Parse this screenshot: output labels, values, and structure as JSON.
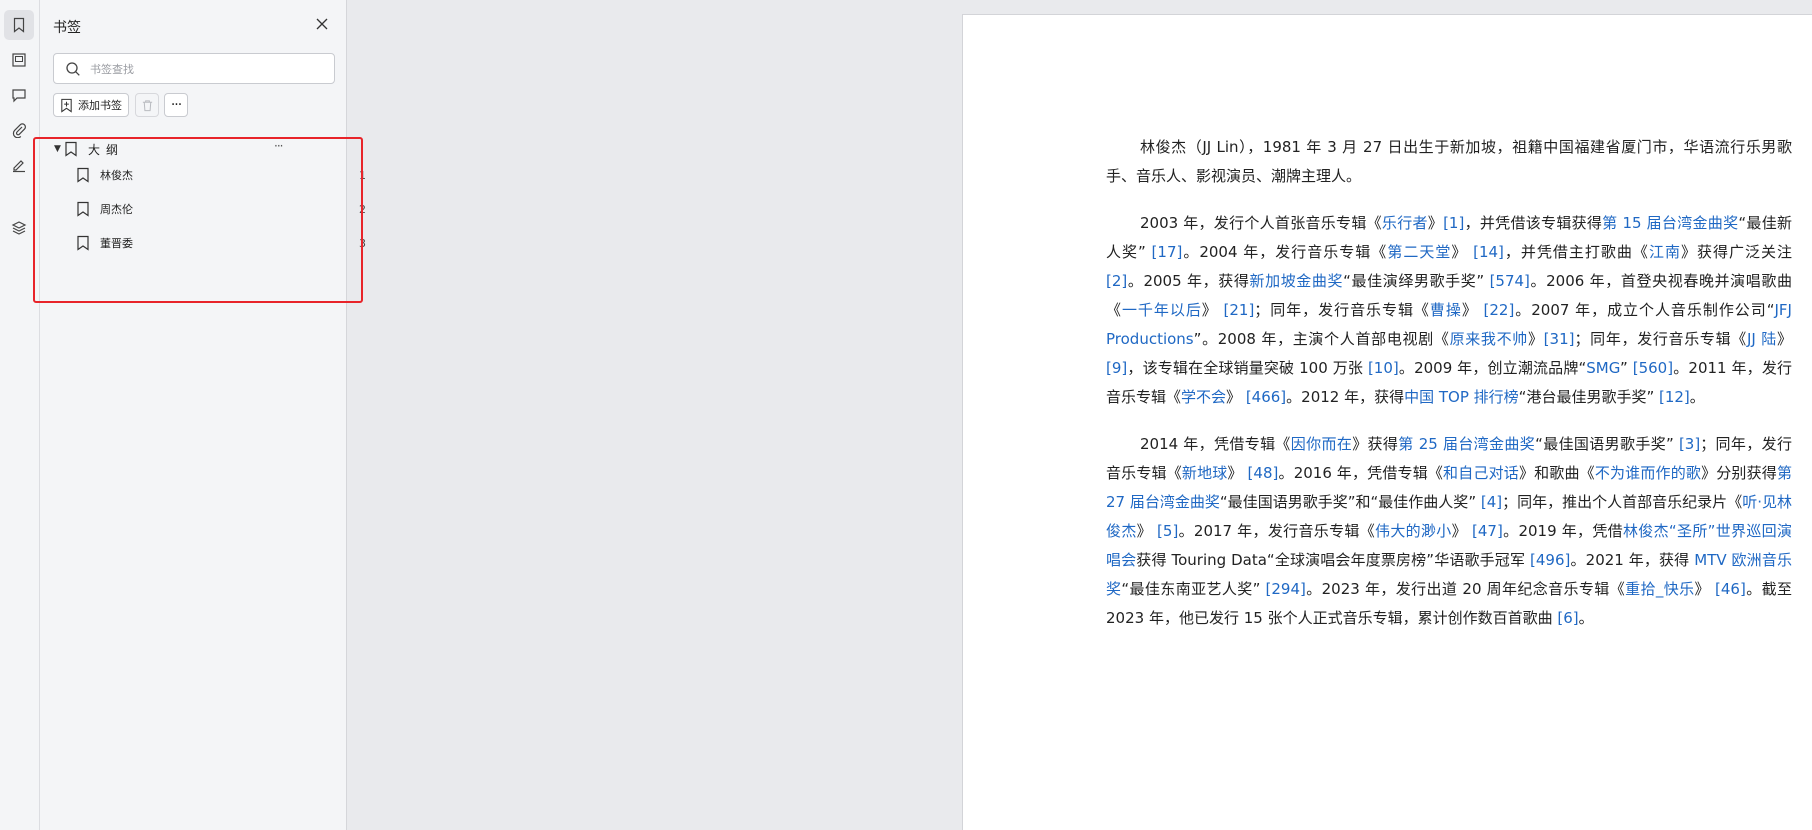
{
  "rail": {
    "items": [
      {
        "icon": "bookmark-icon",
        "active": true
      },
      {
        "icon": "image-icon",
        "active": false
      },
      {
        "icon": "comment-icon",
        "active": false
      },
      {
        "icon": "attachment-icon",
        "active": false
      },
      {
        "icon": "signature-icon",
        "active": false
      },
      {
        "icon": "layers-icon",
        "active": false
      }
    ]
  },
  "bookmark_panel": {
    "title": "书签",
    "search_placeholder": "书签查找",
    "add_label": "添加书签",
    "more_glyph": "···",
    "root": {
      "label": "大纲",
      "more": "···"
    },
    "items": [
      {
        "label": "林俊杰",
        "page": "1"
      },
      {
        "label": "周杰伦",
        "page": "2"
      },
      {
        "label": "董晋委",
        "page": "3"
      }
    ],
    "highlight_color": "#e8242a"
  },
  "document": {
    "link_color": "#1f68c4",
    "paragraphs": [
      [
        {
          "t": "林俊杰（JJ Lin），1981 年 3 月 27 日出生于新加坡，祖籍中国福建省厦门市，华语流行乐男歌手、音乐人、影视演员、潮牌主理人。"
        }
      ],
      [
        {
          "t": "2003 年，发行个人首张音乐专辑《"
        },
        {
          "t": "乐行者",
          "link": true
        },
        {
          "t": "》"
        },
        {
          "t": "[1]",
          "link": true
        },
        {
          "t": "，并凭借该专辑获得"
        },
        {
          "t": "第 15 届台湾金曲奖",
          "link": true
        },
        {
          "t": "“最佳新人奖” "
        },
        {
          "t": "[17]",
          "link": true
        },
        {
          "t": "。2004 年，发行音乐专辑《"
        },
        {
          "t": "第二天堂",
          "link": true
        },
        {
          "t": "》 "
        },
        {
          "t": "[14]",
          "link": true
        },
        {
          "t": "，并凭借主打歌曲《"
        },
        {
          "t": "江南",
          "link": true
        },
        {
          "t": "》获得广泛关注 "
        },
        {
          "t": "[2]",
          "link": true
        },
        {
          "t": "。2005 年，获得"
        },
        {
          "t": "新加坡金曲奖",
          "link": true
        },
        {
          "t": "“最佳演绎男歌手奖” "
        },
        {
          "t": "[574]",
          "link": true
        },
        {
          "t": "。2006 年，首登央视春晚并演唱歌曲《"
        },
        {
          "t": "一千年以后",
          "link": true
        },
        {
          "t": "》 "
        },
        {
          "t": "[21]",
          "link": true
        },
        {
          "t": "；同年，发行音乐专辑《"
        },
        {
          "t": "曹操",
          "link": true
        },
        {
          "t": "》 "
        },
        {
          "t": "[22]",
          "link": true
        },
        {
          "t": "。2007 年，成立个人音乐制作公司“"
        },
        {
          "t": "JFJ Productions",
          "link": true
        },
        {
          "t": "”。2008 年，主演个人首部电视剧《"
        },
        {
          "t": "原来我不帅",
          "link": true
        },
        {
          "t": "》"
        },
        {
          "t": "[31]",
          "link": true
        },
        {
          "t": "；同年，发行音乐专辑《"
        },
        {
          "t": "JJ 陆",
          "link": true
        },
        {
          "t": "》 "
        },
        {
          "t": "[9]",
          "link": true
        },
        {
          "t": "，该专辑在全球销量突破 100 万张 "
        },
        {
          "t": "[10]",
          "link": true
        },
        {
          "t": "。2009 年，创立潮流品牌“"
        },
        {
          "t": "SMG",
          "link": true
        },
        {
          "t": "” "
        },
        {
          "t": "[560]",
          "link": true
        },
        {
          "t": "。2011 年，发行音乐专辑《"
        },
        {
          "t": "学不会",
          "link": true
        },
        {
          "t": "》 "
        },
        {
          "t": "[466]",
          "link": true
        },
        {
          "t": "。2012 年，获得"
        },
        {
          "t": "中国 TOP 排行榜",
          "link": true
        },
        {
          "t": "“港台最佳男歌手奖” "
        },
        {
          "t": "[12]",
          "link": true
        },
        {
          "t": "。"
        }
      ],
      [
        {
          "t": "2014 年，凭借专辑《"
        },
        {
          "t": "因你而在",
          "link": true
        },
        {
          "t": "》获得"
        },
        {
          "t": "第 25 届台湾金曲奖",
          "link": true
        },
        {
          "t": "“最佳国语男歌手奖” "
        },
        {
          "t": "[3]",
          "link": true
        },
        {
          "t": "；同年，发行音乐专辑《"
        },
        {
          "t": "新地球",
          "link": true
        },
        {
          "t": "》 "
        },
        {
          "t": "[48]",
          "link": true
        },
        {
          "t": "。2016 年，凭借专辑《"
        },
        {
          "t": "和自己对话",
          "link": true
        },
        {
          "t": "》和歌曲《"
        },
        {
          "t": "不为谁而作的歌",
          "link": true
        },
        {
          "t": "》分别获得"
        },
        {
          "t": "第 27 届台湾金曲奖",
          "link": true
        },
        {
          "t": "“最佳国语男歌手奖”和“最佳作曲人奖” "
        },
        {
          "t": "[4]",
          "link": true
        },
        {
          "t": "；同年，推出个人首部音乐纪录片《"
        },
        {
          "t": "听·见林俊杰",
          "link": true
        },
        {
          "t": "》 "
        },
        {
          "t": "[5]",
          "link": true
        },
        {
          "t": "。2017 年，发行音乐专辑《"
        },
        {
          "t": "伟大的渺小",
          "link": true
        },
        {
          "t": "》 "
        },
        {
          "t": "[47]",
          "link": true
        },
        {
          "t": "。2019 年，凭借"
        },
        {
          "t": "林俊杰“圣所”世界巡回演唱会",
          "link": true
        },
        {
          "t": "获得 Touring Data“全球演唱会年度票房榜”华语歌手冠军 "
        },
        {
          "t": "[496]",
          "link": true
        },
        {
          "t": "。2021 年，获得 "
        },
        {
          "t": "MTV 欧洲音乐奖",
          "link": true
        },
        {
          "t": "“最佳东南亚艺人奖” "
        },
        {
          "t": "[294]",
          "link": true
        },
        {
          "t": "。2023 年，发行出道 20 周年纪念音乐专辑《"
        },
        {
          "t": "重拾_快乐",
          "link": true
        },
        {
          "t": "》 "
        },
        {
          "t": "[46]",
          "link": true
        },
        {
          "t": "。截至 2023 年，他已发行 15 张个人正式音乐专辑，累计创作数百首歌曲 "
        },
        {
          "t": "[6]",
          "link": true
        },
        {
          "t": "。"
        }
      ]
    ]
  }
}
